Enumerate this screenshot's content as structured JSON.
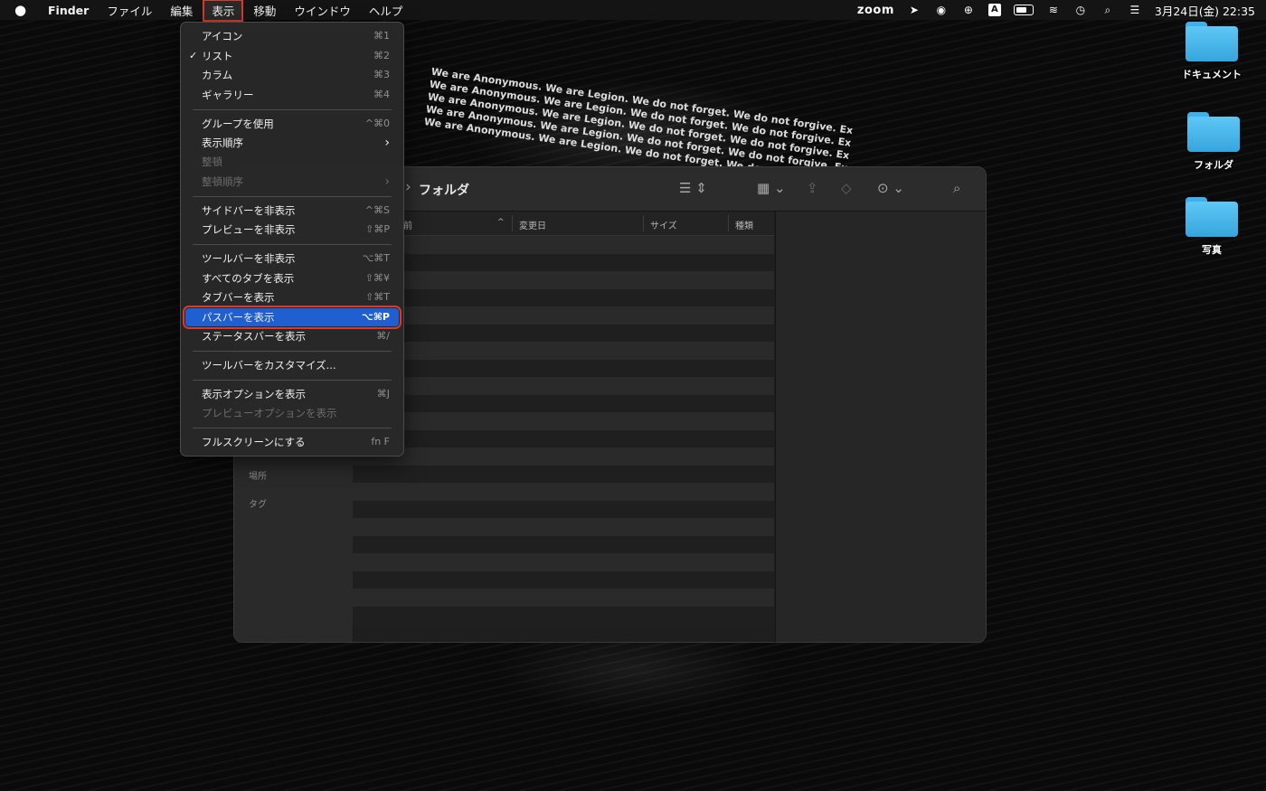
{
  "menubar": {
    "app": "Finder",
    "items": [
      "ファイル",
      "編集",
      "表示",
      "移動",
      "ウインドウ",
      "ヘルプ"
    ],
    "active_item": "表示",
    "status": {
      "zoom": "zoom",
      "datetime": "3月24日(金) 22:35",
      "input_source": "A"
    }
  },
  "desktop": {
    "icons": [
      "ドキュメント",
      "フォルダ",
      "写真"
    ]
  },
  "finder": {
    "title": "フォルダ",
    "sidebar": {
      "locations": "場所",
      "tags": "タグ"
    },
    "columns": {
      "name": "前",
      "modified": "変更日",
      "size": "サイズ",
      "kind": "種類"
    }
  },
  "view_menu": {
    "items": [
      {
        "label": "アイコン",
        "shortcut": "⌘1"
      },
      {
        "label": "リスト",
        "shortcut": "⌘2",
        "checked": true
      },
      {
        "label": "カラム",
        "shortcut": "⌘3"
      },
      {
        "label": "ギャラリー",
        "shortcut": "⌘4"
      },
      {
        "label": "グループを使用",
        "shortcut": "^⌘0"
      },
      {
        "label": "表示順序",
        "submenu": true
      },
      {
        "label": "整頓",
        "disabled": true
      },
      {
        "label": "整頓順序",
        "submenu": true,
        "disabled": true
      },
      {
        "label": "サイドバーを非表示",
        "shortcut": "^⌘S"
      },
      {
        "label": "プレビューを非表示",
        "shortcut": "⇧⌘P"
      },
      {
        "label": "ツールバーを非表示",
        "shortcut": "⌥⌘T"
      },
      {
        "label": "すべてのタブを表示",
        "shortcut": "⇧⌘¥"
      },
      {
        "label": "タブバーを表示",
        "shortcut": "⇧⌘T"
      },
      {
        "label": "パスバーを表示",
        "shortcut": "⌥⌘P",
        "highlighted": true
      },
      {
        "label": "ステータスバーを表示",
        "shortcut": "⌘/"
      },
      {
        "label": "ツールバーをカスタマイズ..."
      },
      {
        "label": "表示オプションを表示",
        "shortcut": "⌘J"
      },
      {
        "label": "プレビューオプションを表示",
        "disabled": true
      },
      {
        "label": "フルスクリーンにする",
        "shortcut": "fn F"
      }
    ]
  },
  "wallpaper_text": "We are Anonymous. We are Legion. We do not forget. We do not forgive. Expect us."
}
